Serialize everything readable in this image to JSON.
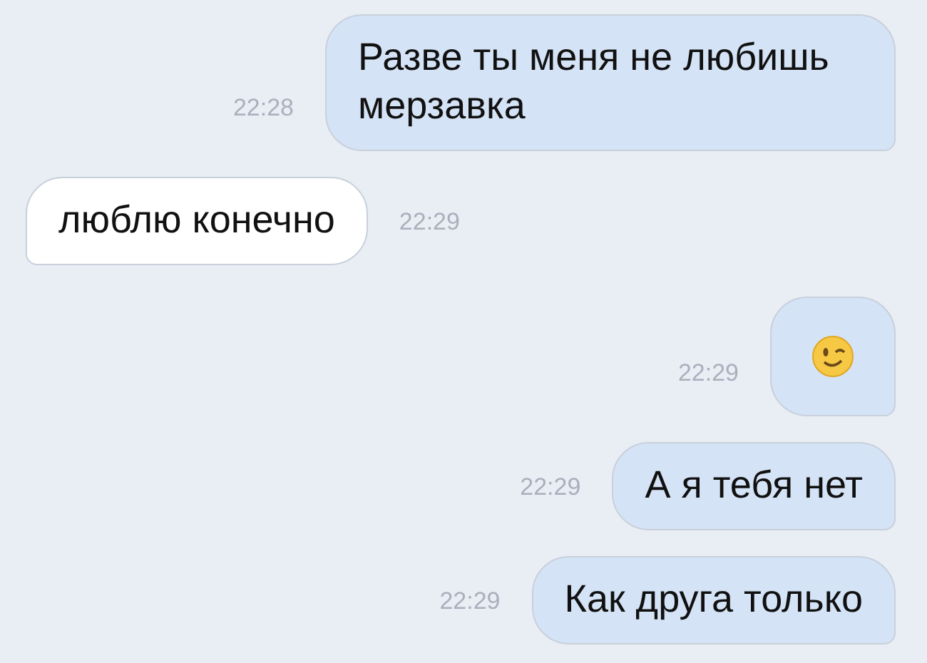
{
  "messages": [
    {
      "kind": "text",
      "outgoing": true,
      "text": "Разве ты меня не любишь мерзавка",
      "time": "22:28"
    },
    {
      "kind": "text",
      "outgoing": false,
      "text": "люблю конечно",
      "time": "22:29"
    },
    {
      "kind": "emoji",
      "outgoing": true,
      "time": "22:29"
    },
    {
      "kind": "text",
      "outgoing": true,
      "text": "А я тебя нет",
      "time": "22:29"
    },
    {
      "kind": "text",
      "outgoing": true,
      "text": "Как друга только",
      "time": "22:29"
    }
  ]
}
